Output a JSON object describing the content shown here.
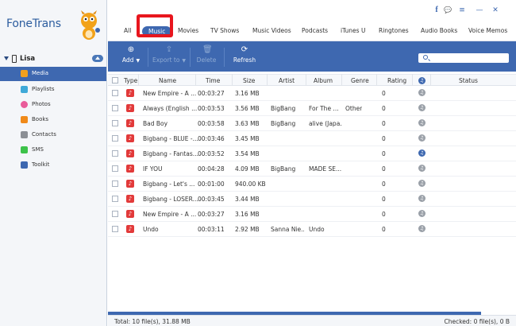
{
  "app": {
    "logo": "FoneTrans"
  },
  "device": {
    "name": "Lisa"
  },
  "sidebar": {
    "items": [
      {
        "label": "Media",
        "icon": "media-icon",
        "color": "#f0a020",
        "active": true
      },
      {
        "label": "Playlists",
        "icon": "playlist-icon",
        "color": "#3fa9d8",
        "active": false
      },
      {
        "label": "Photos",
        "icon": "photo-icon",
        "color": "#e95c9a",
        "active": false
      },
      {
        "label": "Books",
        "icon": "book-icon",
        "color": "#f08a1a",
        "active": false
      },
      {
        "label": "Contacts",
        "icon": "contacts-icon",
        "color": "#8b8f95",
        "active": false
      },
      {
        "label": "SMS",
        "icon": "sms-icon",
        "color": "#3cc24a",
        "active": false
      },
      {
        "label": "Toolkit",
        "icon": "toolkit-icon",
        "color": "#3e68b0",
        "active": false
      }
    ]
  },
  "titlebar": {
    "facebook": "f",
    "chat": "💬",
    "menu": "≡",
    "minimize": "—",
    "close": "✕"
  },
  "tabs": [
    {
      "label": "All",
      "active": false
    },
    {
      "label": "Music",
      "active": true
    },
    {
      "label": "Movies",
      "active": false
    },
    {
      "label": "TV Shows",
      "active": false
    },
    {
      "label": "Music Videos",
      "active": false
    },
    {
      "label": "Podcasts",
      "active": false
    },
    {
      "label": "iTunes U",
      "active": false
    },
    {
      "label": "Ringtones",
      "active": false
    },
    {
      "label": "Audio Books",
      "active": false
    },
    {
      "label": "Voice Memos",
      "active": false
    }
  ],
  "toolbar": {
    "add": "Add",
    "export": "Export to",
    "delete": "Delete",
    "refresh": "Refresh",
    "search_placeholder": ""
  },
  "table": {
    "headers": [
      "Type",
      "Name",
      "Time",
      "Size",
      "Artist",
      "Album",
      "Genre",
      "Rating",
      "Status"
    ],
    "rows": [
      {
        "name": "New Empire - A ...",
        "time": "00:03:27",
        "size": "3.16 MB",
        "artist": "",
        "album": "",
        "genre": "",
        "rating": "0",
        "sync": "grey"
      },
      {
        "name": "Always (English ...",
        "time": "00:03:53",
        "size": "3.56 MB",
        "artist": "BigBang",
        "album": "For The ...",
        "genre": "Other",
        "rating": "0",
        "sync": "grey"
      },
      {
        "name": "Bad Boy",
        "time": "00:03:58",
        "size": "3.63 MB",
        "artist": "BigBang",
        "album": "alive (Japa...",
        "genre": "",
        "rating": "0",
        "sync": "grey"
      },
      {
        "name": "Bigbang - BLUE -...",
        "time": "00:03:46",
        "size": "3.45 MB",
        "artist": "",
        "album": "",
        "genre": "",
        "rating": "0",
        "sync": "grey"
      },
      {
        "name": "Bigbang - Fantas...",
        "time": "00:03:52",
        "size": "3.54 MB",
        "artist": "",
        "album": "",
        "genre": "",
        "rating": "0",
        "sync": "blue"
      },
      {
        "name": "IF YOU",
        "time": "00:04:28",
        "size": "4.09 MB",
        "artist": "BigBang",
        "album": "MADE SE...",
        "genre": "",
        "rating": "0",
        "sync": "grey"
      },
      {
        "name": "Bigbang - Let's ...",
        "time": "00:01:00",
        "size": "940.00 KB",
        "artist": "",
        "album": "",
        "genre": "",
        "rating": "0",
        "sync": "grey"
      },
      {
        "name": "Bigbang - LOSER...",
        "time": "00:03:45",
        "size": "3.44 MB",
        "artist": "",
        "album": "",
        "genre": "",
        "rating": "0",
        "sync": "grey"
      },
      {
        "name": "New Empire - A ...",
        "time": "00:03:27",
        "size": "3.16 MB",
        "artist": "",
        "album": "",
        "genre": "",
        "rating": "0",
        "sync": "grey"
      },
      {
        "name": "Undo",
        "time": "00:03:11",
        "size": "2.92 MB",
        "artist": "Sanna Nie...",
        "album": "Undo",
        "genre": "",
        "rating": "0",
        "sync": "grey"
      }
    ]
  },
  "status": {
    "total": "Total: 10 file(s), 31.88 MB",
    "checked": "Checked: 0 file(s), 0 B"
  },
  "colors": {
    "accent": "#3e68b0",
    "highlight": "#e8161e",
    "music_icon": "#e23a3a"
  }
}
